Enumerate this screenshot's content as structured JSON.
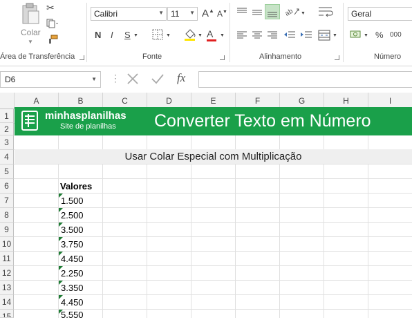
{
  "ribbon": {
    "clipboard": {
      "paste_label": "Colar",
      "group_label": "Área de Transferência"
    },
    "font": {
      "name": "Calibri",
      "size": "11",
      "grow": "A",
      "shrink": "A",
      "bold": "N",
      "italic": "I",
      "underline": "S",
      "color_letter": "A",
      "group_label": "Fonte"
    },
    "alignment": {
      "group_label": "Alinhamento"
    },
    "number": {
      "format": "Geral",
      "percent": "%",
      "thousands": "000",
      "group_label": "Número"
    }
  },
  "formula_bar": {
    "cell_ref": "D6",
    "fx": "fx",
    "value": ""
  },
  "columns": [
    "A",
    "B",
    "C",
    "D",
    "E",
    "F",
    "G",
    "H",
    "I"
  ],
  "rows": [
    "1",
    "2",
    "3",
    "4",
    "5",
    "6",
    "7",
    "8",
    "9",
    "10",
    "11",
    "12",
    "13",
    "14",
    "15"
  ],
  "sheet": {
    "logo_name": "minhasplanilhas",
    "logo_tagline": "Site de planilhas",
    "banner_title": "Converter Texto em Número",
    "subtitle": "Usar Colar Especial com Multiplicação",
    "values_header": "Valores",
    "values": [
      "1.500",
      "2.500",
      "3.500",
      "3.750",
      "4.450",
      "2.250",
      "3.350",
      "4.450",
      "5.550"
    ]
  },
  "colors": {
    "brand_green": "#1aa04a",
    "error_triangle": "#1e7c34",
    "font_color_bar": "#e02020"
  }
}
